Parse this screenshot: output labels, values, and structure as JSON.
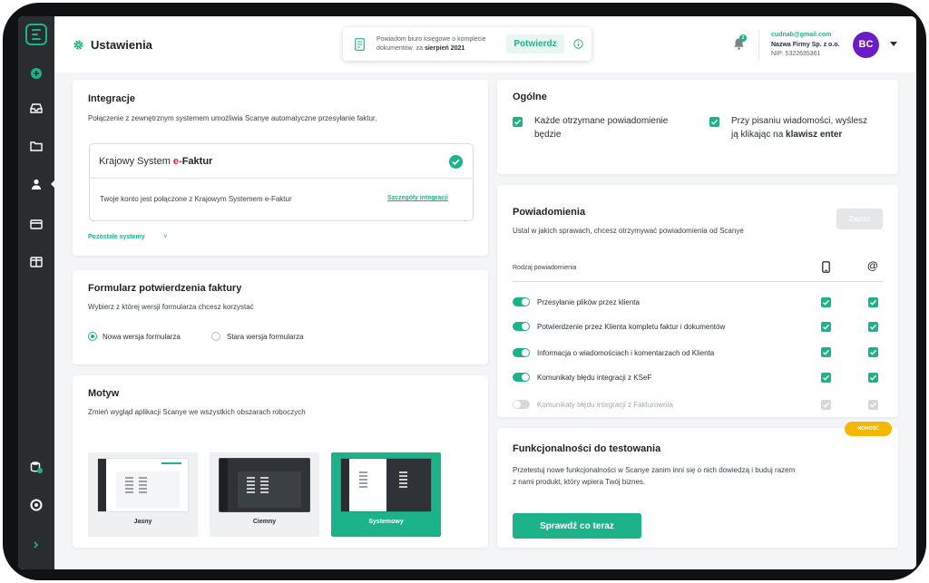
{
  "topbar": {
    "title": "Ustawienia",
    "notice_line1": "Powiadom biuro księgowe o komplecie",
    "notice_line2_prefix": "dokumentów",
    "notice_line2_mid": "za",
    "notice_line2_month": "sierpień 2021",
    "confirm_label": "Potwierdz",
    "notification_count": "2",
    "account_email": "cudnab@gmail.com",
    "account_company": "Nazwa Firmy Sp. z o.o.",
    "account_nip": "NIP: 5322635361",
    "avatar_initials": "BC"
  },
  "integrations": {
    "title": "Integracje",
    "subtitle": "Połączenie z zewnętrznym systemem umożliwia Scanye automatyczne przesyłanie faktur.",
    "system_name_prefix": "Krajowy System",
    "system_name_e": "e-",
    "system_name_bold": "Faktur",
    "status": "Twoje konto jest połączone z Krajowym Systemem e-Faktur",
    "details_link": "Szczegóły integracji",
    "other_systems": "Pozostałe systemy"
  },
  "form": {
    "title": "Formularz potwierdzenia faktury",
    "subtitle": "Wybierz z której wersji formularza chcesz korzystać",
    "options": [
      {
        "label": "Nowa wersja formularza",
        "selected": true
      },
      {
        "label": "Stara wersja formularza",
        "selected": false
      }
    ]
  },
  "theme": {
    "title": "Motyw",
    "subtitle": "Zmień wygląd aplikacji Scanye we wszystkich obszarach roboczych",
    "options": [
      {
        "label": "Jasny",
        "selected": false
      },
      {
        "label": "Ciemny",
        "selected": false
      },
      {
        "label": "Systemowy",
        "selected": true
      }
    ]
  },
  "general": {
    "title": "Ogólne",
    "options": [
      {
        "line1": "Każde otrzymane powiadomienie",
        "line2": "będzie",
        "checked": true
      },
      {
        "line1": "Przy pisaniu wiadomości, wyślesz",
        "line2": "ją klikając na",
        "line2_bold": "klawisz enter",
        "checked": true
      }
    ]
  },
  "notifications": {
    "title": "Powiadomienia",
    "subtitle": "Ustal w jakich sprawach, chcesz otrzymywać powiadomienia od Scanye",
    "save_label": "Zapisz",
    "column_header": "Rodzaj powiadomienia",
    "rows": [
      {
        "label": "Przesyłanie plików przez klienta",
        "enabled": true,
        "phone": true,
        "email": true
      },
      {
        "label": "Potwierdzenie przez Klienta kompletu faktur i dokumentów",
        "enabled": true,
        "phone": true,
        "email": true
      },
      {
        "label": "Informacja o wiadomościach i komentarzach od Klienta",
        "enabled": true,
        "phone": true,
        "email": true
      },
      {
        "label": "Komunikaty błędu integracji z KSeF",
        "enabled": true,
        "phone": true,
        "email": true
      },
      {
        "label": "Komunikaty błędu integracji z Fakturownia",
        "enabled": false,
        "phone": true,
        "email": true
      }
    ]
  },
  "beta": {
    "badge": "NOWOŚĆ",
    "title": "Funkcjonalności do testowania",
    "line1": "Przetestuj nowe funkcjonalności w Scanye zanim inni się o nich dowiedzą i buduj razem",
    "line2": "z nami produkt, który wpiera Twój biznes.",
    "cta": "Sprawdź co teraz"
  },
  "colors": {
    "accent": "#1db38a",
    "sidebar": "#2a2d30",
    "avatar": "#6a1cc7",
    "badge": "#f5b800"
  }
}
